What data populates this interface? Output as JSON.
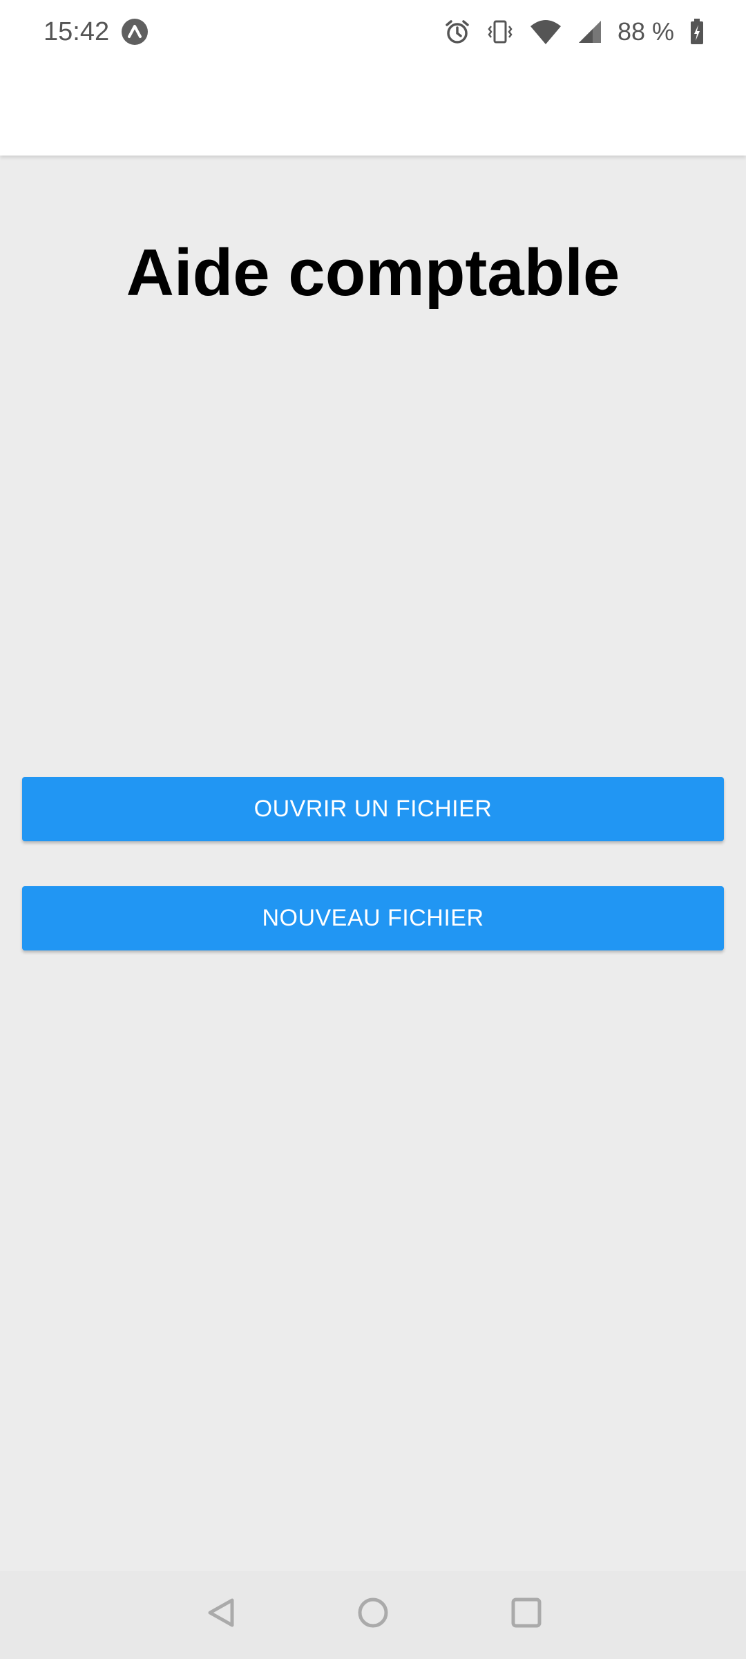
{
  "status_bar": {
    "time": "15:42",
    "app_icon": "expo-app-icon",
    "icons": [
      "alarm-icon",
      "vibrate-icon",
      "wifi-icon",
      "cell-signal-icon",
      "battery-charging-icon"
    ],
    "battery_text": "88 %"
  },
  "main": {
    "title": "Aide comptable",
    "open_button_label": "OUVRIR UN FICHIER",
    "new_button_label": "NOUVEAU FICHIER"
  },
  "nav_bar": {
    "icons": [
      "back-icon",
      "home-icon",
      "recents-icon"
    ]
  },
  "colors": {
    "background": "#ececec",
    "header": "#ffffff",
    "button": "#2196f3",
    "button_text": "#ffffff",
    "title": "#000000"
  }
}
